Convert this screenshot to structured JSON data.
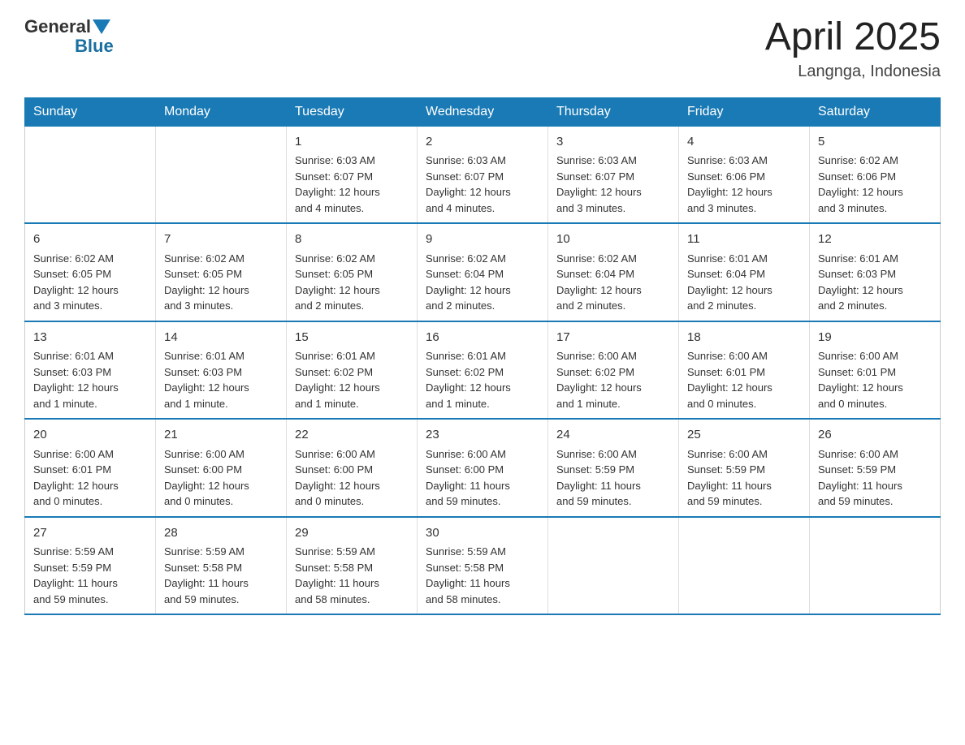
{
  "header": {
    "logo_general": "General",
    "logo_blue": "Blue",
    "month_year": "April 2025",
    "location": "Langnga, Indonesia"
  },
  "days_of_week": [
    "Sunday",
    "Monday",
    "Tuesday",
    "Wednesday",
    "Thursday",
    "Friday",
    "Saturday"
  ],
  "weeks": [
    [
      {
        "day": "",
        "info": ""
      },
      {
        "day": "",
        "info": ""
      },
      {
        "day": "1",
        "info": "Sunrise: 6:03 AM\nSunset: 6:07 PM\nDaylight: 12 hours\nand 4 minutes."
      },
      {
        "day": "2",
        "info": "Sunrise: 6:03 AM\nSunset: 6:07 PM\nDaylight: 12 hours\nand 4 minutes."
      },
      {
        "day": "3",
        "info": "Sunrise: 6:03 AM\nSunset: 6:07 PM\nDaylight: 12 hours\nand 3 minutes."
      },
      {
        "day": "4",
        "info": "Sunrise: 6:03 AM\nSunset: 6:06 PM\nDaylight: 12 hours\nand 3 minutes."
      },
      {
        "day": "5",
        "info": "Sunrise: 6:02 AM\nSunset: 6:06 PM\nDaylight: 12 hours\nand 3 minutes."
      }
    ],
    [
      {
        "day": "6",
        "info": "Sunrise: 6:02 AM\nSunset: 6:05 PM\nDaylight: 12 hours\nand 3 minutes."
      },
      {
        "day": "7",
        "info": "Sunrise: 6:02 AM\nSunset: 6:05 PM\nDaylight: 12 hours\nand 3 minutes."
      },
      {
        "day": "8",
        "info": "Sunrise: 6:02 AM\nSunset: 6:05 PM\nDaylight: 12 hours\nand 2 minutes."
      },
      {
        "day": "9",
        "info": "Sunrise: 6:02 AM\nSunset: 6:04 PM\nDaylight: 12 hours\nand 2 minutes."
      },
      {
        "day": "10",
        "info": "Sunrise: 6:02 AM\nSunset: 6:04 PM\nDaylight: 12 hours\nand 2 minutes."
      },
      {
        "day": "11",
        "info": "Sunrise: 6:01 AM\nSunset: 6:04 PM\nDaylight: 12 hours\nand 2 minutes."
      },
      {
        "day": "12",
        "info": "Sunrise: 6:01 AM\nSunset: 6:03 PM\nDaylight: 12 hours\nand 2 minutes."
      }
    ],
    [
      {
        "day": "13",
        "info": "Sunrise: 6:01 AM\nSunset: 6:03 PM\nDaylight: 12 hours\nand 1 minute."
      },
      {
        "day": "14",
        "info": "Sunrise: 6:01 AM\nSunset: 6:03 PM\nDaylight: 12 hours\nand 1 minute."
      },
      {
        "day": "15",
        "info": "Sunrise: 6:01 AM\nSunset: 6:02 PM\nDaylight: 12 hours\nand 1 minute."
      },
      {
        "day": "16",
        "info": "Sunrise: 6:01 AM\nSunset: 6:02 PM\nDaylight: 12 hours\nand 1 minute."
      },
      {
        "day": "17",
        "info": "Sunrise: 6:00 AM\nSunset: 6:02 PM\nDaylight: 12 hours\nand 1 minute."
      },
      {
        "day": "18",
        "info": "Sunrise: 6:00 AM\nSunset: 6:01 PM\nDaylight: 12 hours\nand 0 minutes."
      },
      {
        "day": "19",
        "info": "Sunrise: 6:00 AM\nSunset: 6:01 PM\nDaylight: 12 hours\nand 0 minutes."
      }
    ],
    [
      {
        "day": "20",
        "info": "Sunrise: 6:00 AM\nSunset: 6:01 PM\nDaylight: 12 hours\nand 0 minutes."
      },
      {
        "day": "21",
        "info": "Sunrise: 6:00 AM\nSunset: 6:00 PM\nDaylight: 12 hours\nand 0 minutes."
      },
      {
        "day": "22",
        "info": "Sunrise: 6:00 AM\nSunset: 6:00 PM\nDaylight: 12 hours\nand 0 minutes."
      },
      {
        "day": "23",
        "info": "Sunrise: 6:00 AM\nSunset: 6:00 PM\nDaylight: 11 hours\nand 59 minutes."
      },
      {
        "day": "24",
        "info": "Sunrise: 6:00 AM\nSunset: 5:59 PM\nDaylight: 11 hours\nand 59 minutes."
      },
      {
        "day": "25",
        "info": "Sunrise: 6:00 AM\nSunset: 5:59 PM\nDaylight: 11 hours\nand 59 minutes."
      },
      {
        "day": "26",
        "info": "Sunrise: 6:00 AM\nSunset: 5:59 PM\nDaylight: 11 hours\nand 59 minutes."
      }
    ],
    [
      {
        "day": "27",
        "info": "Sunrise: 5:59 AM\nSunset: 5:59 PM\nDaylight: 11 hours\nand 59 minutes."
      },
      {
        "day": "28",
        "info": "Sunrise: 5:59 AM\nSunset: 5:58 PM\nDaylight: 11 hours\nand 59 minutes."
      },
      {
        "day": "29",
        "info": "Sunrise: 5:59 AM\nSunset: 5:58 PM\nDaylight: 11 hours\nand 58 minutes."
      },
      {
        "day": "30",
        "info": "Sunrise: 5:59 AM\nSunset: 5:58 PM\nDaylight: 11 hours\nand 58 minutes."
      },
      {
        "day": "",
        "info": ""
      },
      {
        "day": "",
        "info": ""
      },
      {
        "day": "",
        "info": ""
      }
    ]
  ]
}
